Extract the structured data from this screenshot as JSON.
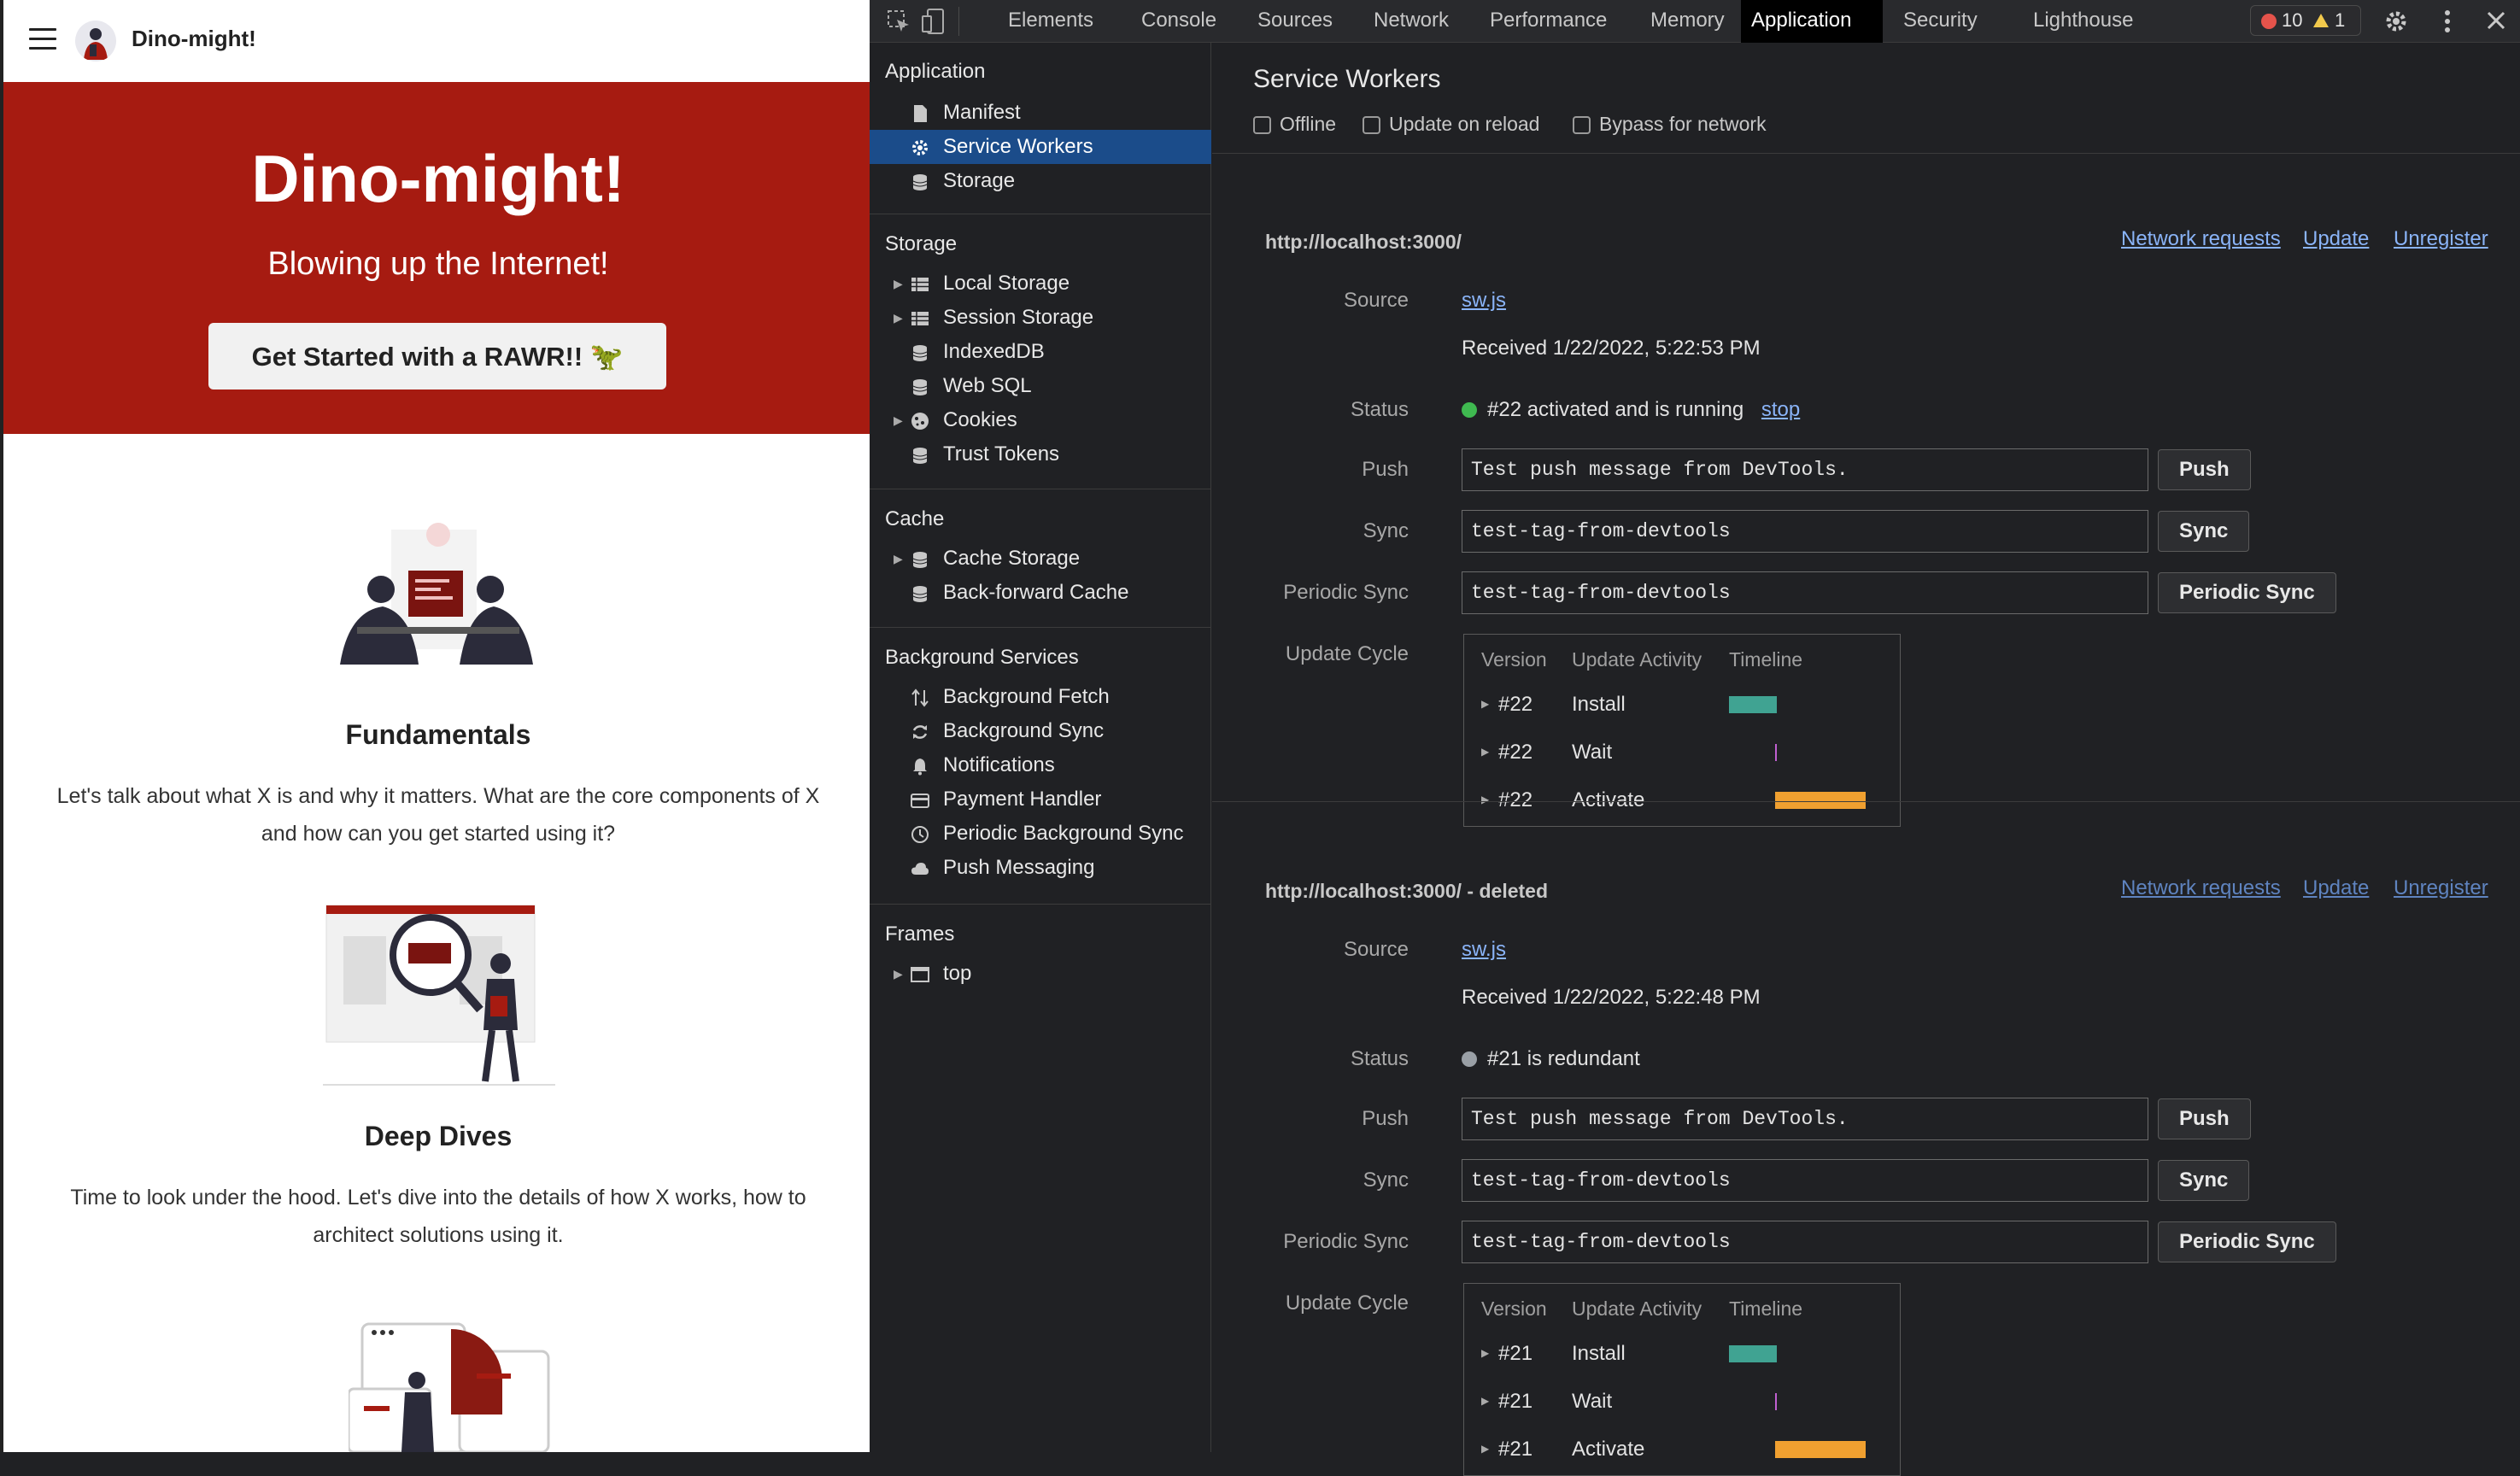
{
  "site": {
    "title": "Dino-might!",
    "hero_title": "Dino-might!",
    "hero_subtitle": "Blowing up the Internet!",
    "hero_button": "Get Started with a RAWR!! 🦖",
    "sections": [
      {
        "title": "Fundamentals",
        "body": "Let's talk about what X is and why it matters. What are the core components of X and how can you get started using it?"
      },
      {
        "title": "Deep Dives",
        "body": "Time to look under the hood. Let's dive into the details of how X works, how to architect solutions using it."
      }
    ]
  },
  "devtools": {
    "tabs": [
      "Elements",
      "Console",
      "Sources",
      "Network",
      "Performance",
      "Memory",
      "Application",
      "Security",
      "Lighthouse"
    ],
    "active_tab": "Application",
    "error_count": "10",
    "warning_count": "1",
    "sidebar": {
      "application_heading": "Application",
      "application_items": [
        "Manifest",
        "Service Workers",
        "Storage"
      ],
      "storage_heading": "Storage",
      "storage_items": [
        "Local Storage",
        "Session Storage",
        "IndexedDB",
        "Web SQL",
        "Cookies",
        "Trust Tokens"
      ],
      "cache_heading": "Cache",
      "cache_items": [
        "Cache Storage",
        "Back-forward Cache"
      ],
      "bg_heading": "Background Services",
      "bg_items": [
        "Background Fetch",
        "Background Sync",
        "Notifications",
        "Payment Handler",
        "Periodic Background Sync",
        "Push Messaging"
      ],
      "frames_heading": "Frames",
      "frames_items": [
        "top"
      ]
    },
    "main": {
      "title": "Service Workers",
      "options": [
        "Offline",
        "Update on reload",
        "Bypass for network"
      ],
      "labels": {
        "source": "Source",
        "status": "Status",
        "push": "Push",
        "sync": "Sync",
        "periodic": "Periodic Sync",
        "cycle": "Update Cycle"
      },
      "links": {
        "network": "Network requests",
        "update": "Update",
        "unregister": "Unregister",
        "stop": "stop"
      },
      "buttons": {
        "push": "Push",
        "sync": "Sync",
        "periodic": "Periodic Sync"
      },
      "cycle_headers": [
        "Version",
        "Update Activity",
        "Timeline"
      ],
      "workers": [
        {
          "origin": "http://localhost:3000/",
          "source": "sw.js",
          "received": "Received 1/22/2022, 5:22:53 PM",
          "status": "#22 activated and is running",
          "status_color": "#3fb950",
          "push_value": "Test push message from DevTools.",
          "sync_value": "test-tag-from-devtools",
          "periodic_value": "test-tag-from-devtools",
          "cycle": [
            {
              "version": "#22",
              "activity": "Install"
            },
            {
              "version": "#22",
              "activity": "Wait"
            },
            {
              "version": "#22",
              "activity": "Activate"
            }
          ]
        },
        {
          "origin": "http://localhost:3000/ - deleted",
          "source": "sw.js",
          "received": "Received 1/22/2022, 5:22:48 PM",
          "status": "#21 is redundant",
          "status_color": "#9aa0a6",
          "push_value": "Test push message from DevTools.",
          "sync_value": "test-tag-from-devtools",
          "periodic_value": "test-tag-from-devtools",
          "cycle": [
            {
              "version": "#21",
              "activity": "Install"
            },
            {
              "version": "#21",
              "activity": "Wait"
            },
            {
              "version": "#21",
              "activity": "Activate"
            }
          ]
        }
      ]
    }
  }
}
